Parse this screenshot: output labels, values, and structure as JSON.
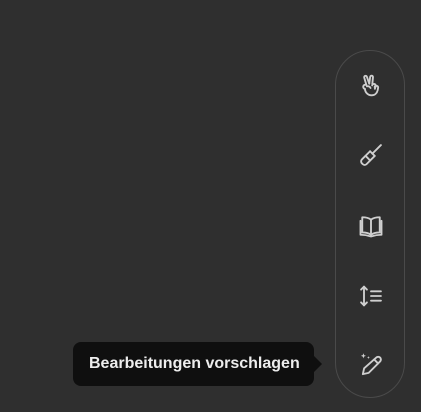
{
  "tooltip": {
    "text": "Bearbeitungen vorschlagen"
  },
  "toolbar": {
    "buttons": [
      {
        "icon": "peace-hand-icon"
      },
      {
        "icon": "paintbrush-icon"
      },
      {
        "icon": "book-icon"
      },
      {
        "icon": "text-length-icon"
      },
      {
        "icon": "magic-pen-icon",
        "active_tooltip": true
      }
    ]
  }
}
